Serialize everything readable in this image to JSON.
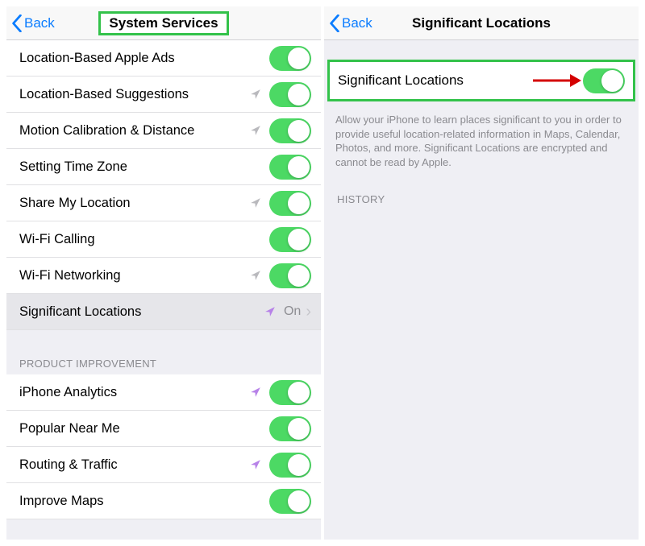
{
  "left": {
    "back": "Back",
    "title": "System Services",
    "items": [
      {
        "label": "Location-Based Apple Ads",
        "loc": null
      },
      {
        "label": "Location-Based Suggestions",
        "loc": "grey"
      },
      {
        "label": "Motion Calibration & Distance",
        "loc": "grey"
      },
      {
        "label": "Setting Time Zone",
        "loc": null
      },
      {
        "label": "Share My Location",
        "loc": "grey"
      },
      {
        "label": "Wi-Fi Calling",
        "loc": null
      },
      {
        "label": "Wi-Fi Networking",
        "loc": "grey"
      }
    ],
    "navrow": {
      "label": "Significant Locations",
      "value": "On"
    },
    "section1": "PRODUCT IMPROVEMENT",
    "items2": [
      {
        "label": "iPhone Analytics",
        "loc": "purple"
      },
      {
        "label": "Popular Near Me",
        "loc": null
      },
      {
        "label": "Routing & Traffic",
        "loc": "purple"
      },
      {
        "label": "Improve Maps",
        "loc": null
      }
    ]
  },
  "right": {
    "back": "Back",
    "title": "Significant Locations",
    "row_label": "Significant Locations",
    "desc": "Allow your iPhone to learn places significant to you in order to provide useful location-related information in Maps, Calendar, Photos, and more. Significant Locations are encrypted and cannot be read by Apple.",
    "section": "HISTORY"
  }
}
